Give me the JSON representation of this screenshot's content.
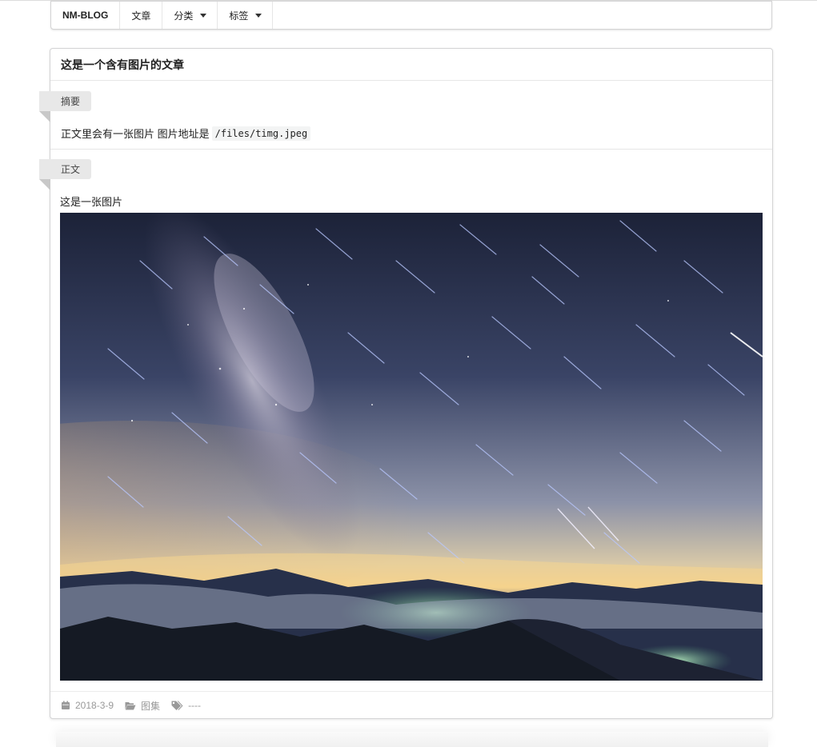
{
  "navbar": {
    "brand": "NM-BLOG",
    "items": [
      {
        "label": "文章",
        "dropdown": false
      },
      {
        "label": "分类",
        "dropdown": true
      },
      {
        "label": "标签",
        "dropdown": true
      }
    ]
  },
  "article": {
    "title": "这是一个含有图片的文章",
    "summary_label": "摘要",
    "summary_text": "正文里会有一张图片 图片地址是",
    "summary_code": "/files/timg.jpeg",
    "body_label": "正文",
    "body_text": "这是一张图片",
    "image": {
      "icon": "starry-night-landscape-photo"
    },
    "meta": {
      "date": "2018-3-9",
      "category": "图集",
      "tags": "----",
      "date_icon": "calendar-icon",
      "category_icon": "folder-open-icon",
      "tags_icon": "tags-icon"
    }
  },
  "colors": {
    "ribbon_bg": "#e8e8e8",
    "meta_text": "#999999",
    "border": "#d4d4d5"
  }
}
